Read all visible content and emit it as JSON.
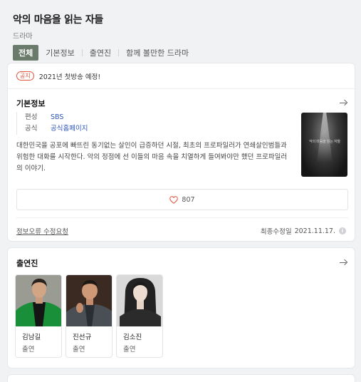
{
  "show": {
    "title": "악의 마음을 읽는 자들",
    "genre": "드라마"
  },
  "tabs": [
    {
      "label": "전체",
      "active": true
    },
    {
      "label": "기본정보",
      "active": false
    },
    {
      "label": "출연진",
      "active": false
    },
    {
      "label": "함께 볼만한 드라마",
      "active": false
    }
  ],
  "notice": {
    "badge": "공지",
    "text": "2021년 첫방송 예정!"
  },
  "basic_info": {
    "heading": "기본정보",
    "rows": [
      {
        "key": "편성",
        "value": "SBS"
      },
      {
        "key": "공식",
        "value": "공식홈페이지"
      }
    ],
    "synopsis": "대한민국을 공포에 빠뜨린 동기없는 살인이 급증하던 시절, 최초의 프로파일러가 연쇄살인범들과 위험한 대화를 시작한다. 악의 정점에 선 이들의 마음 속을 치열하게 들여봐야만 했던 프로파일러의 이야기.",
    "poster_text": "악의 마음을 읽는 자들",
    "likes": "807",
    "error_report": "정보오류 수정요청",
    "last_modified_label": "최종수정일",
    "last_modified_date": "2021.11.17."
  },
  "cast": {
    "heading": "출연진",
    "members": [
      {
        "name": "김남길",
        "role": "출연"
      },
      {
        "name": "진선규",
        "role": "출연"
      },
      {
        "name": "김소진",
        "role": "출연"
      }
    ]
  },
  "colors": {
    "active_tab": "#6b7b6b",
    "link": "#2e55b8",
    "notice_accent": "#e2533d",
    "heart": "#e2533d"
  }
}
